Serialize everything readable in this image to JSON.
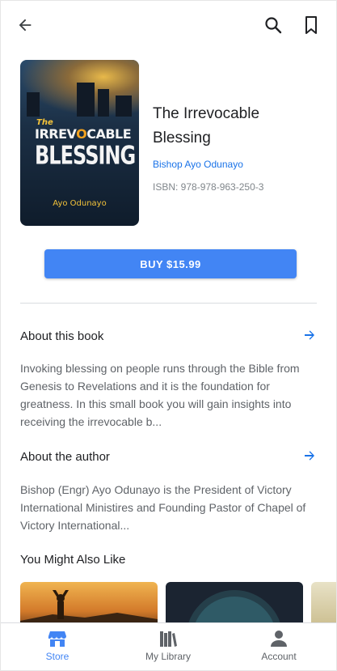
{
  "book": {
    "title": "The Irrevocable Blessing",
    "author": "Bishop Ayo Odunayo",
    "isbn": "ISBN: 978-978-963-250-3",
    "cover": {
      "the": "The",
      "irr_1": "IRREV",
      "irr_o": "O",
      "irr_2": "CABLE",
      "blessing": "BLESSING",
      "author": "Ayo Odunayo"
    }
  },
  "buy_label": "BUY $15.99",
  "about_book": {
    "title": "About this book",
    "text": "Invoking blessing on people runs through the Bible from Genesis to Revelations and it is the foundation for greatness. In this small book you will gain insights into receiving the irrevocable b..."
  },
  "about_author": {
    "title": "About the author",
    "text": "Bishop (Engr) Ayo Odunayo is the President of Victory International Ministires and Founding Pastor of Chapel of Victory International..."
  },
  "recommend": {
    "title": "You Might Also Like"
  },
  "nav": {
    "store": "Store",
    "library": "My Library",
    "account": "Account"
  },
  "colors": {
    "accent": "#4285f4",
    "link": "#1a73e8",
    "active_nav": "#4285f4",
    "inactive_nav": "#5f6368"
  }
}
